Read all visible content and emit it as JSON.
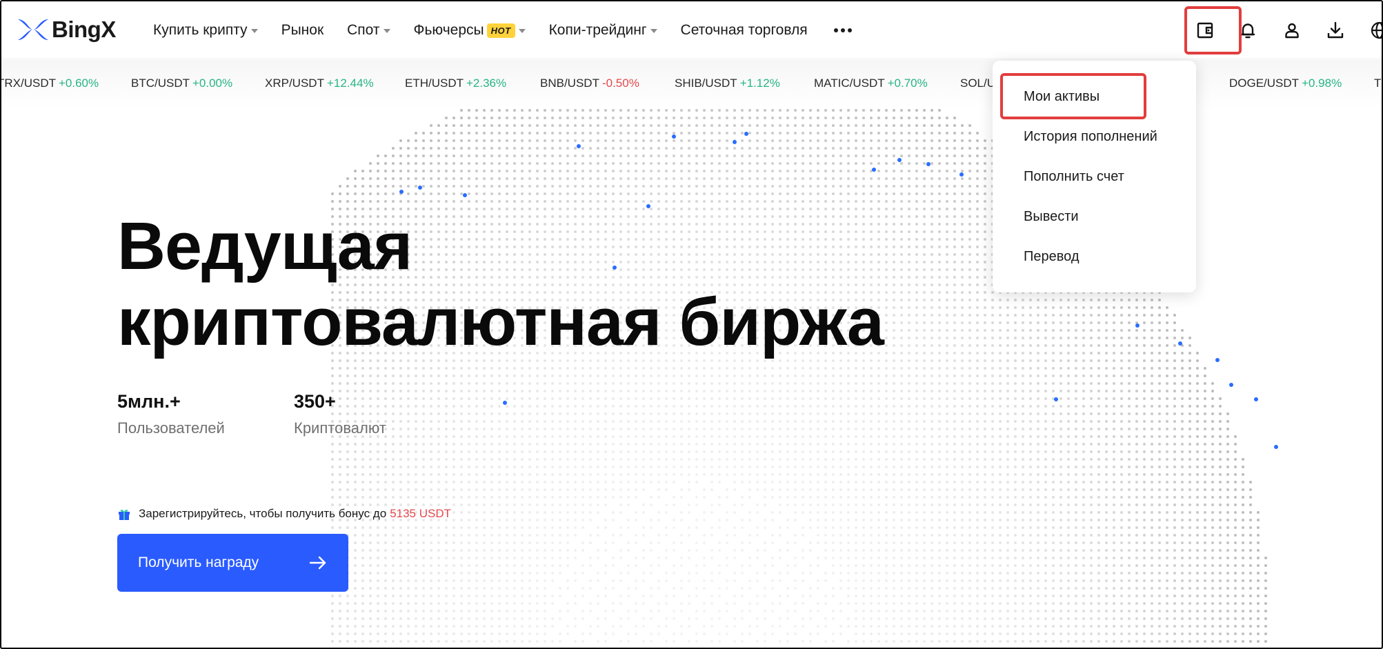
{
  "brand": {
    "name": "BingX",
    "color": "#2a5bff"
  },
  "nav": {
    "items": [
      {
        "label": "Купить крипту",
        "has_caret": true
      },
      {
        "label": "Рынок",
        "has_caret": false
      },
      {
        "label": "Спот",
        "has_caret": true
      },
      {
        "label": "Фьючерсы",
        "badge": "HOT",
        "has_caret": true
      },
      {
        "label": "Копи-трейдинг",
        "has_caret": true
      },
      {
        "label": "Сеточная торговля",
        "has_caret": false
      }
    ],
    "more_icon": "more-horizontal-icon"
  },
  "header_icons": [
    "wallet-icon",
    "bell-icon",
    "user-icon",
    "download-icon",
    "globe-icon"
  ],
  "ticker": [
    {
      "pair": "TRX/USDT",
      "change": "+0.60%"
    },
    {
      "pair": "BTC/USDT",
      "change": "+0.00%"
    },
    {
      "pair": "XRP/USDT",
      "change": "+12.44%"
    },
    {
      "pair": "ETH/USDT",
      "change": "+2.36%"
    },
    {
      "pair": "BNB/USDT",
      "change": "-0.50%"
    },
    {
      "pair": "SHIB/USDT",
      "change": "+1.12%"
    },
    {
      "pair": "MATIC/USDT",
      "change": "+0.70%"
    },
    {
      "pair": "SOL/USDT",
      "change": ""
    },
    {
      "pair": "DOGE/USDT",
      "change": "+0.98%"
    },
    {
      "pair": "TI",
      "change": ""
    }
  ],
  "hero": {
    "title_line1": "Ведущая",
    "title_line2": "криптовалютная биржа",
    "stats": [
      {
        "value": "5млн.+",
        "label": "Пользователей"
      },
      {
        "value": "350+",
        "label": "Криптовалют"
      }
    ],
    "bonus_text": "Зарегистрируйтесь, чтобы получить бонус до",
    "bonus_amount": "5135 USDT",
    "cta_label": "Получить награду"
  },
  "wallet_menu": {
    "items": [
      "Мои активы",
      "История пополнений",
      "Пополнить счет",
      "Вывести",
      "Перевод"
    ],
    "highlighted": "Мои активы"
  },
  "colors": {
    "positive": "#26b485",
    "negative": "#e5484d",
    "highlight": "#e23d3d"
  }
}
